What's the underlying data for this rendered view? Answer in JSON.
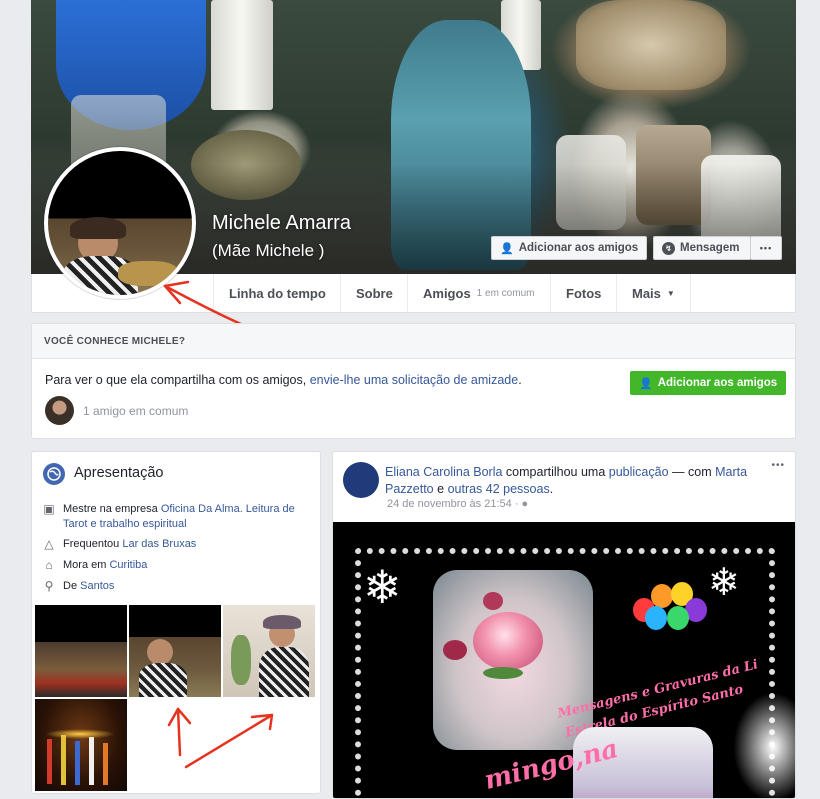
{
  "profile": {
    "name": "Michele Amarra",
    "alt_name": "(Mãe Michele )"
  },
  "cover_actions": {
    "add_friend": "Adicionar aos amigos",
    "message": "Mensagem",
    "more": "•••"
  },
  "nav": {
    "timeline": "Linha do tempo",
    "about": "Sobre",
    "friends": "Amigos",
    "friends_sub": "1 em comum",
    "photos": "Fotos",
    "more": "Mais"
  },
  "know": {
    "title": "VOCÊ CONHECE MICHELE?",
    "text_prefix": "Para ver o que ela compartilha com os amigos,",
    "text_link": "envie-lhe uma solicitação de amizade",
    "text_suffix": ".",
    "button": "Adicionar aos amigos",
    "mutual": "1 amigo em comum"
  },
  "intro": {
    "title": "Apresentação",
    "work_prefix": "Mestre na empresa",
    "work_link": "Oficina Da Alma. Leitura de Tarot e trabalho espiritual",
    "study_prefix": "Frequentou",
    "study_link": "Lar das Bruxas",
    "lives_prefix": "Mora em",
    "lives_link": "Curitiba",
    "from_prefix": "De",
    "from_link": "Santos"
  },
  "post": {
    "author": "Eliana Carolina Borla",
    "action_prefix": "compartilhou uma",
    "action_link": "publicação",
    "with_text": "— com",
    "tagged": "Marta Pazzetto",
    "and_text": "e",
    "others": "outras 42 pessoas",
    "period": ".",
    "time": "24 de novembro às 21:54",
    "more": "•••",
    "image_text_1": "Mensagens e Gravuras da Li",
    "image_text_2": "Estrela do Espírito Santo",
    "image_text_3": "mingo,na"
  },
  "colors": {
    "link": "#365899",
    "green": "#42b72a",
    "annotation_red": "#e5331f"
  }
}
